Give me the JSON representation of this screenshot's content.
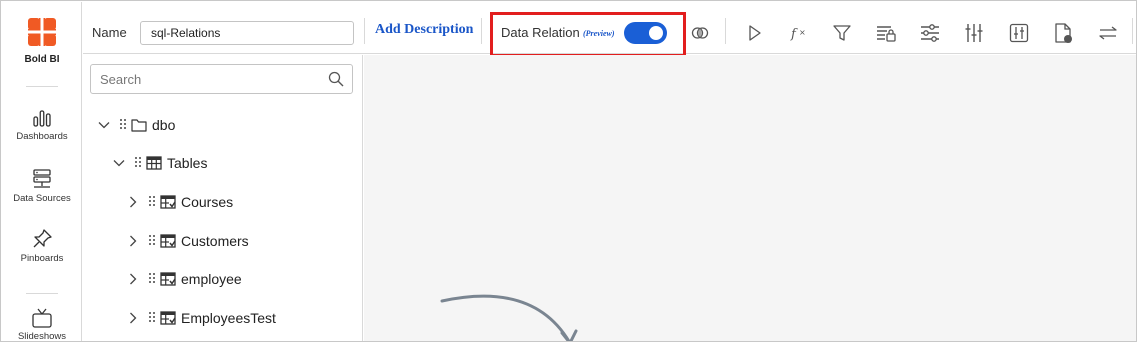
{
  "nav": {
    "brand": "Bold BI",
    "items": [
      {
        "label": "Dashboards",
        "icon": "dashboards-icon"
      },
      {
        "label": "Data Sources",
        "icon": "data-sources-icon"
      },
      {
        "label": "Pinboards",
        "icon": "pin-icon"
      },
      {
        "label": "Slideshows",
        "icon": "slideshow-icon"
      }
    ]
  },
  "toolbar": {
    "name_label": "Name",
    "name_value": "sql-Relations",
    "add_description": "Add Description",
    "data_relation_label": "Data Relation",
    "data_relation_preview": "(Preview)",
    "data_relation_enabled": true,
    "tools": [
      "join-icon",
      "play-icon",
      "function-icon",
      "filter-icon",
      "secured-table-icon",
      "settings-sliders-icon",
      "parameter-icon",
      "column-settings-icon",
      "document-icon",
      "swap-icon"
    ]
  },
  "colors": {
    "accent": "#1a5fd6",
    "highlight": "#e21e1e",
    "brand": "#f05a24"
  },
  "panel": {
    "search_placeholder": "Search",
    "tree": {
      "schema": "dbo",
      "tables_label": "Tables",
      "tables": [
        "Courses",
        "Customers",
        "employee",
        "EmployeesTest"
      ]
    }
  }
}
